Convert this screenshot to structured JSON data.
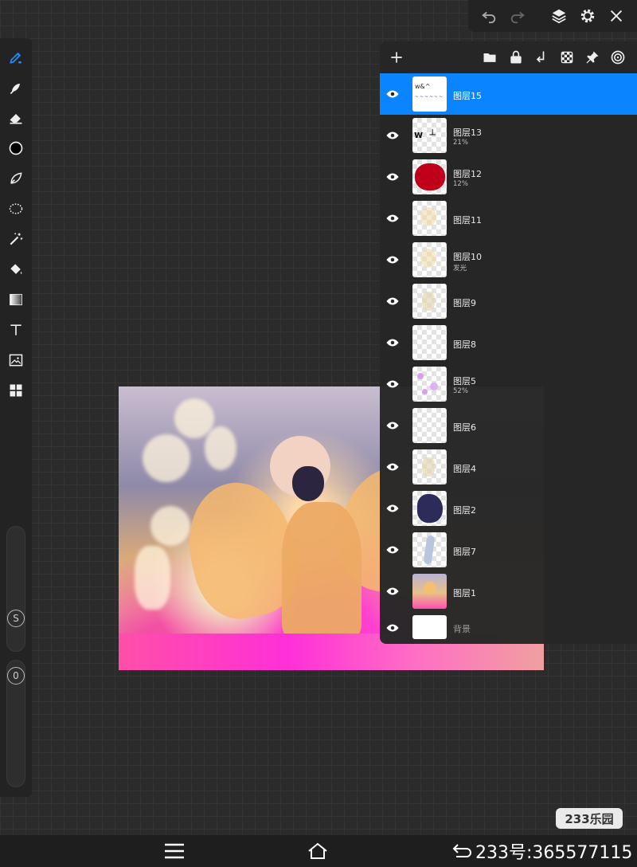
{
  "canvas": {
    "artwork": "character-with-wings-illustration"
  },
  "toolbar_left": {
    "tools": [
      {
        "name": "brush-tool",
        "icon": "brush-icon",
        "active": true
      },
      {
        "name": "smudge-tool",
        "icon": "smudge-icon"
      },
      {
        "name": "eraser-tool",
        "icon": "eraser-icon"
      },
      {
        "name": "color-picker",
        "icon": "color-circle-icon",
        "color": "#000000"
      },
      {
        "name": "lasso-tool",
        "icon": "lasso-icon"
      },
      {
        "name": "selection-tool",
        "icon": "dotted-selection-icon"
      },
      {
        "name": "magic-wand-tool",
        "icon": "magic-wand-icon"
      },
      {
        "name": "fill-tool",
        "icon": "paint-bucket-icon"
      },
      {
        "name": "gradient-tool",
        "icon": "gradient-icon"
      },
      {
        "name": "text-tool",
        "icon": "text-icon"
      },
      {
        "name": "image-tool",
        "icon": "image-icon"
      },
      {
        "name": "more-tools",
        "icon": "grid-icon"
      }
    ],
    "size_slider_label": "S",
    "opacity_slider_label": "0"
  },
  "top_right_toolbar": {
    "buttons": [
      "undo-icon",
      "redo-icon",
      "layers-icon",
      "gear-icon",
      "close-icon"
    ]
  },
  "layers_panel": {
    "header_buttons": [
      "add-icon",
      "folder-icon",
      "lock-icon",
      "merge-down-icon",
      "transparency-icon",
      "pin-icon",
      "target-icon"
    ],
    "layers": [
      {
        "name": "图层15",
        "sub": "",
        "active": true,
        "thumb": "text-sketch"
      },
      {
        "name": "图层13",
        "sub": "21%",
        "active": false,
        "thumb": "black-letters"
      },
      {
        "name": "图层12",
        "sub": "12%",
        "active": false,
        "thumb": "red-blob"
      },
      {
        "name": "图层11",
        "sub": "",
        "active": false,
        "thumb": "light-sparkles"
      },
      {
        "name": "图层10",
        "sub": "发光",
        "active": false,
        "thumb": "light-sparkles"
      },
      {
        "name": "图层9",
        "sub": "",
        "active": false,
        "thumb": "faint-shape"
      },
      {
        "name": "图层8",
        "sub": "",
        "active": false,
        "thumb": "empty"
      },
      {
        "name": "图层5",
        "sub": "52%",
        "active": false,
        "thumb": "purple-dots"
      },
      {
        "name": "图层6",
        "sub": "",
        "active": false,
        "thumb": "empty"
      },
      {
        "name": "图层4",
        "sub": "",
        "active": false,
        "thumb": "faint-shape"
      },
      {
        "name": "图层2",
        "sub": "",
        "active": false,
        "thumb": "navy-blob"
      },
      {
        "name": "图层7",
        "sub": "",
        "active": false,
        "thumb": "blue-stroke"
      },
      {
        "name": "图层1",
        "sub": "",
        "active": false,
        "thumb": "full-artwork"
      },
      {
        "name": "背景",
        "sub": "",
        "active": false,
        "thumb": "white"
      }
    ]
  },
  "system_nav": {
    "buttons": [
      "menu-icon",
      "home-icon",
      "back-icon"
    ],
    "text": "233号:365577115"
  },
  "watermark": "233乐园"
}
